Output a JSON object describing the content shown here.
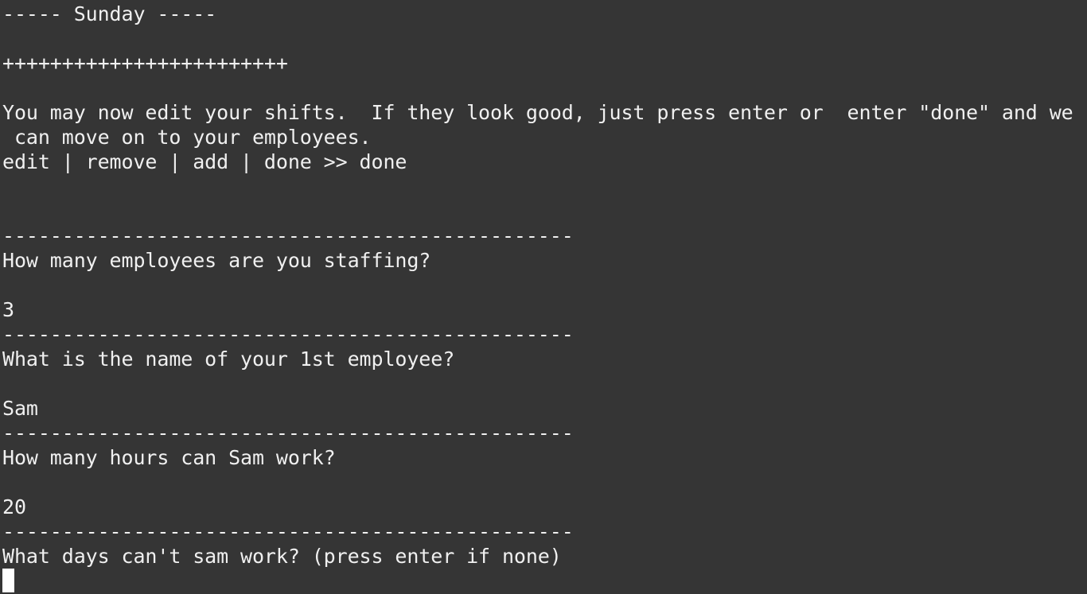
{
  "terminal": {
    "lines": [
      "----- Sunday -----",
      "",
      "++++++++++++++++++++++++",
      "",
      "You may now edit your shifts.  If they look good, just press enter or  enter \"done\" and we",
      " can move on to your employees.",
      "edit | remove | add | done >> done",
      "",
      "",
      "------------------------------------------------",
      "How many employees are you staffing?",
      "",
      "3",
      "------------------------------------------------",
      "What is the name of your 1st employee?",
      "",
      "Sam",
      "------------------------------------------------",
      "How many hours can Sam work?",
      "",
      "20",
      "------------------------------------------------",
      "What days can't sam work? (press enter if none)"
    ]
  },
  "colors": {
    "background": "#353535",
    "foreground": "#f0f0f0",
    "cursor": "#ffffff"
  }
}
